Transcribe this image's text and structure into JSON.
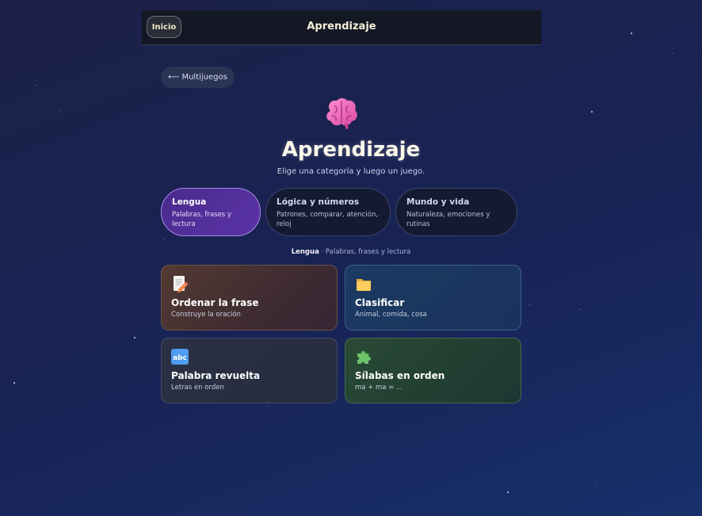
{
  "topbar": {
    "home_label": "Inicio",
    "title": "Aprendizaje"
  },
  "back": {
    "arrow": "⟵",
    "label": "Multijuegos"
  },
  "hero": {
    "icon": "brain-icon",
    "title": "Aprendizaje",
    "subtitle": "Elige una categoría y luego un juego."
  },
  "categories": [
    {
      "title": "Lengua",
      "desc": "Palabras, frases y lectura",
      "active": true
    },
    {
      "title": "Lógica y números",
      "desc": "Patrones, comparar, atención, reloj",
      "active": false
    },
    {
      "title": "Mundo y vida",
      "desc": "Naturaleza, emociones y rutinas",
      "active": false
    }
  ],
  "crumb": {
    "category": "Lengua",
    "separator": " · ",
    "desc": "Palabras, frases y lectura"
  },
  "games": [
    {
      "title": "Ordenar la frase",
      "desc": "Construye la oración",
      "icon": "memo-pencil-icon"
    },
    {
      "title": "Clasificar",
      "desc": "Animal, comida, cosa",
      "icon": "folder-icon"
    },
    {
      "title": "Palabra revuelta",
      "desc": "Letras en orden",
      "icon": "abc-icon"
    },
    {
      "title": "Sílabas en orden",
      "desc": "ma + ma = ...",
      "icon": "puzzle-icon"
    }
  ],
  "colors": {
    "active_category": "#5b34a8",
    "background": "#1a2350",
    "accent_title": "#fbf8ea"
  }
}
